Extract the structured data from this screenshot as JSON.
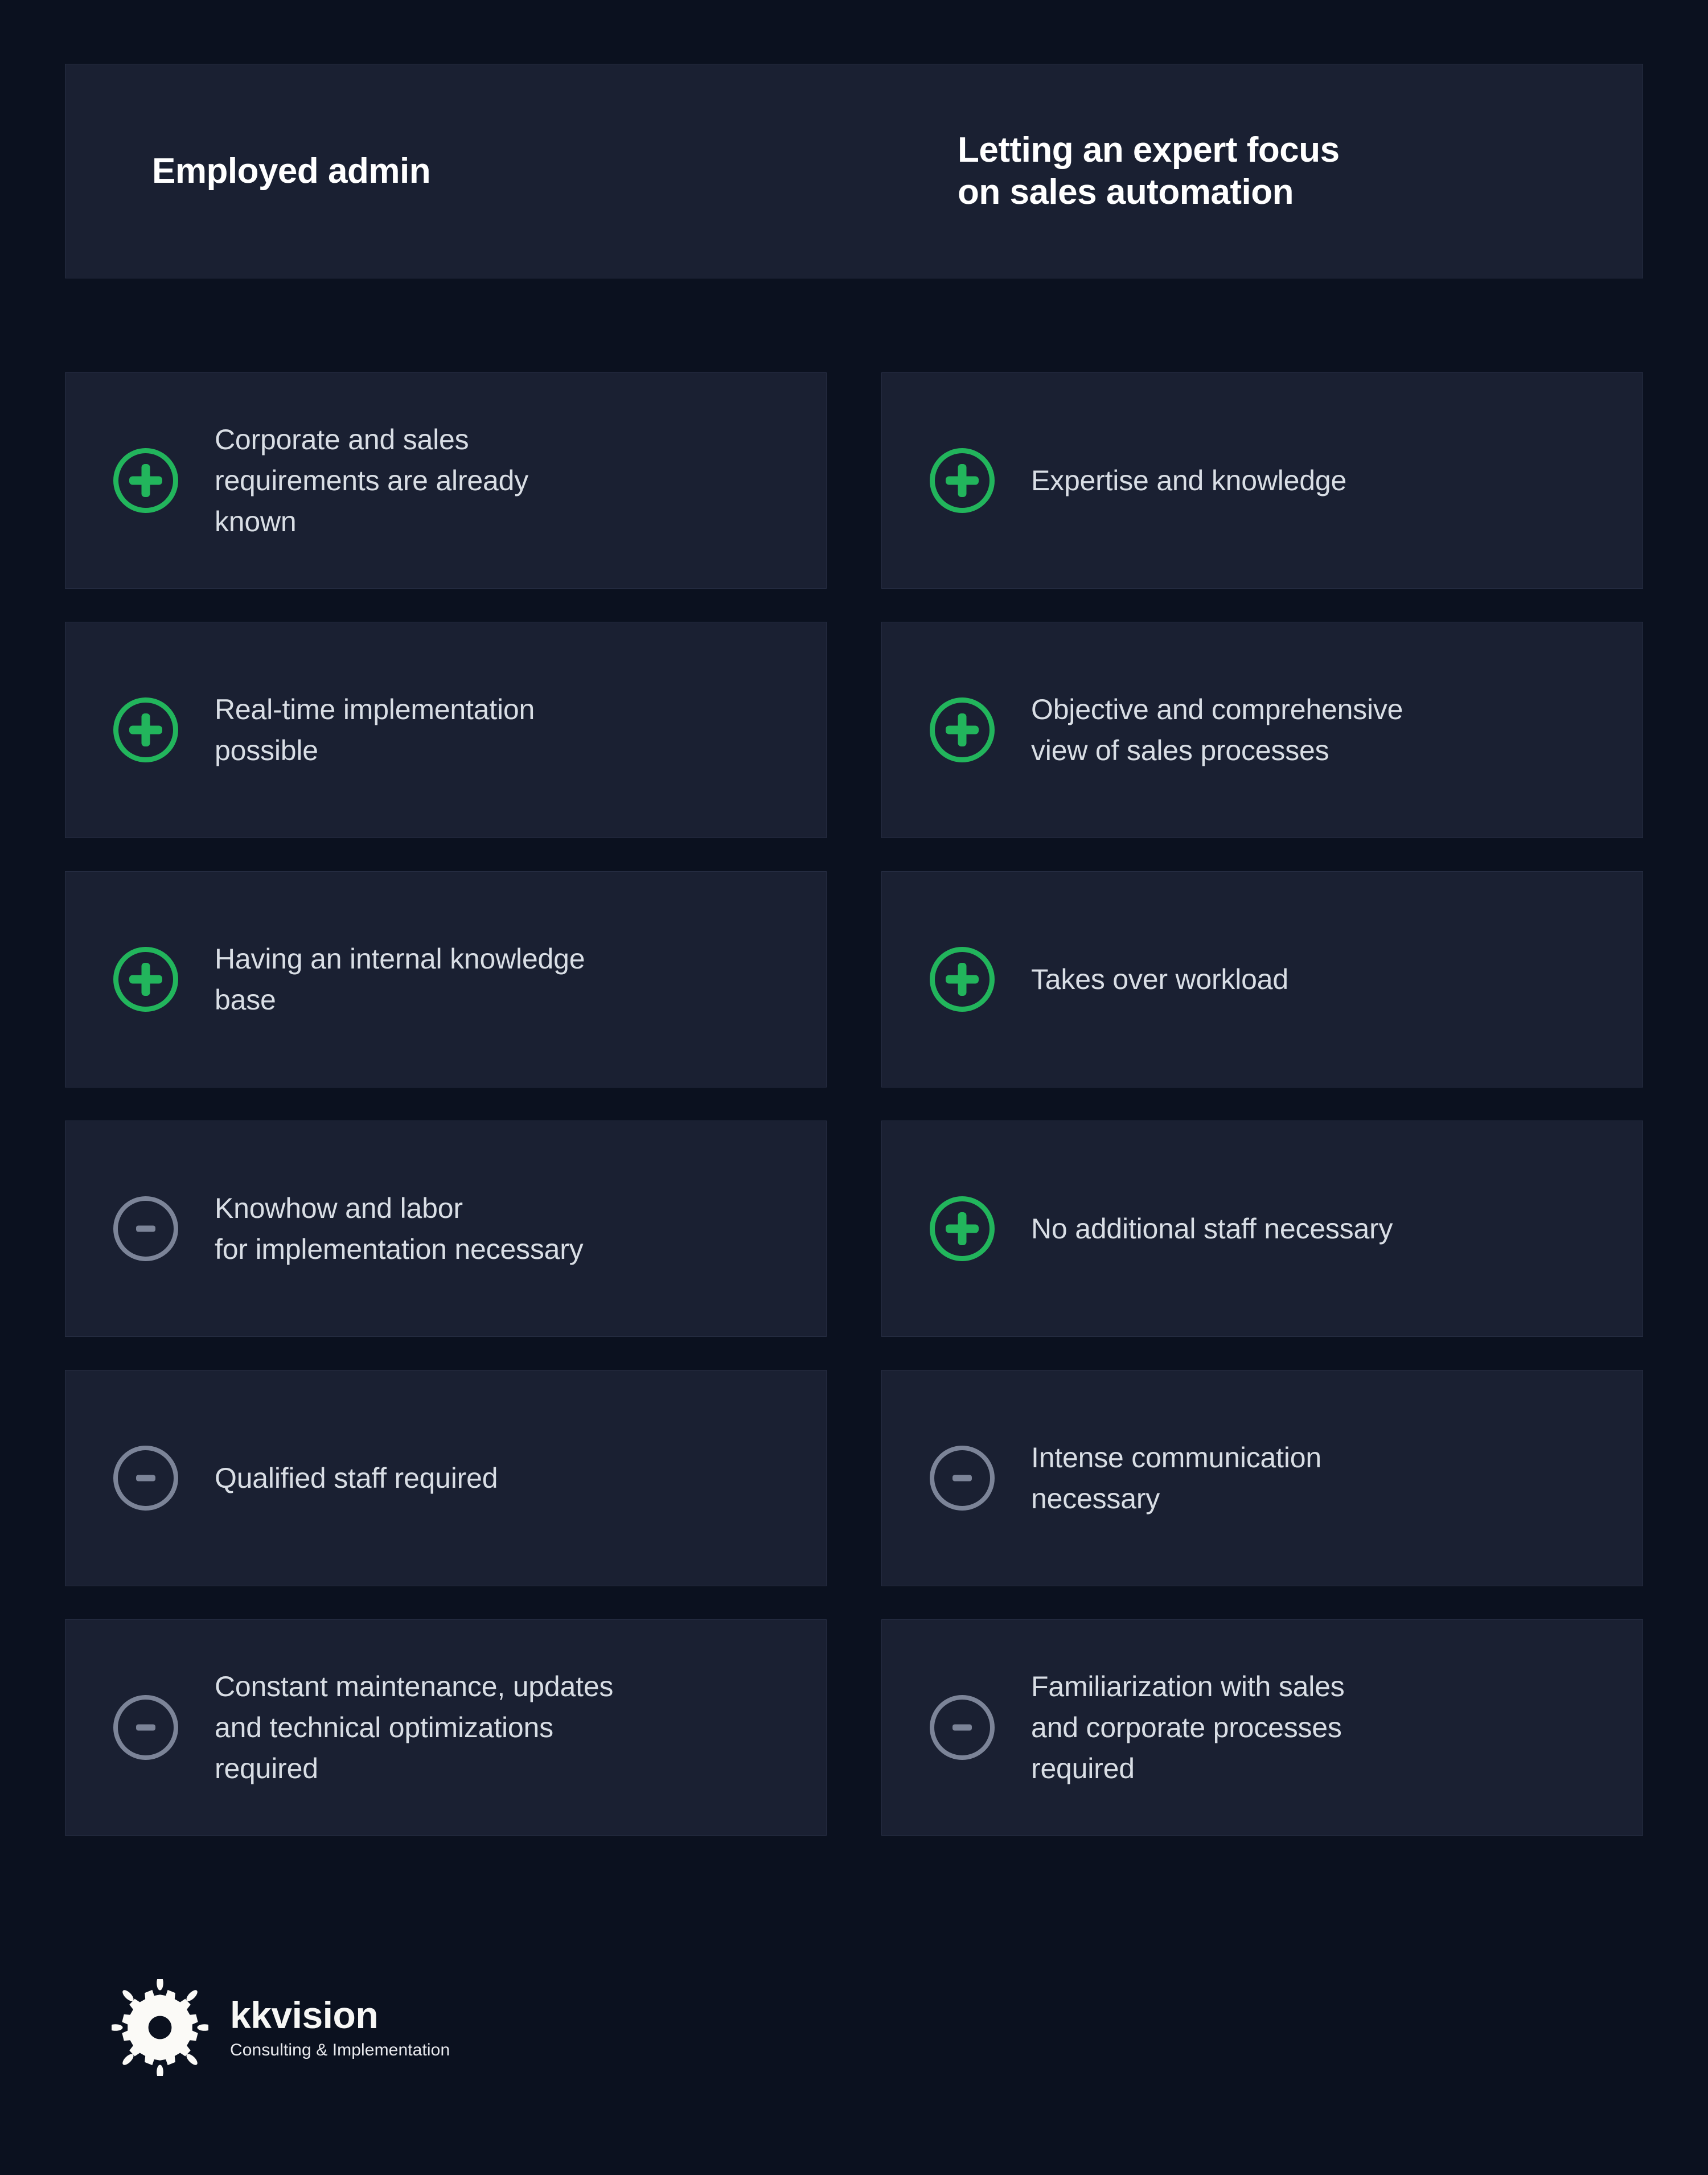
{
  "colors": {
    "page_background": "#0b111f",
    "card_background": "#1a2032",
    "card_border": "#262d42",
    "positive_accent": "#22b55c",
    "negative_accent": "#7c8498",
    "heading_text": "#ffffff",
    "body_text": "#d9dee5"
  },
  "header": {
    "left_title": "Employed admin",
    "right_title": "Letting an expert focus\non sales automation"
  },
  "comparison": {
    "rows": [
      {
        "left": {
          "marker": "plus",
          "marker_label": "plus-icon",
          "text": "Corporate and sales\nrequirements are already\nknown"
        },
        "right": {
          "marker": "plus",
          "marker_label": "plus-icon",
          "text": "Expertise and knowledge"
        }
      },
      {
        "left": {
          "marker": "plus",
          "marker_label": "plus-icon",
          "text": "Real-time implementation\npossible"
        },
        "right": {
          "marker": "plus",
          "marker_label": "plus-icon",
          "text": "Objective and comprehensive\nview of sales processes"
        }
      },
      {
        "left": {
          "marker": "plus",
          "marker_label": "plus-icon",
          "text": "Having an internal knowledge\nbase"
        },
        "right": {
          "marker": "plus",
          "marker_label": "plus-icon",
          "text": "Takes over workload"
        }
      },
      {
        "left": {
          "marker": "minus",
          "marker_label": "minus-icon",
          "text": "Knowhow and labor\nfor implementation necessary"
        },
        "right": {
          "marker": "plus",
          "marker_label": "plus-icon",
          "text": "No additional staff necessary"
        }
      },
      {
        "left": {
          "marker": "minus",
          "marker_label": "minus-icon",
          "text": "Qualified staff required"
        },
        "right": {
          "marker": "minus",
          "marker_label": "minus-icon",
          "text": "Intense communication\nnecessary"
        }
      },
      {
        "left": {
          "marker": "minus",
          "marker_label": "minus-icon",
          "text": "Constant maintenance, updates\nand technical optimizations\nrequired"
        },
        "right": {
          "marker": "minus",
          "marker_label": "minus-icon",
          "text": "Familiarization with sales\nand corporate processes\nrequired"
        }
      }
    ]
  },
  "footer": {
    "logo_icon": "gear-sun-logo-icon",
    "brand_name": "kkvision",
    "tagline": "Consulting & Implementation"
  }
}
